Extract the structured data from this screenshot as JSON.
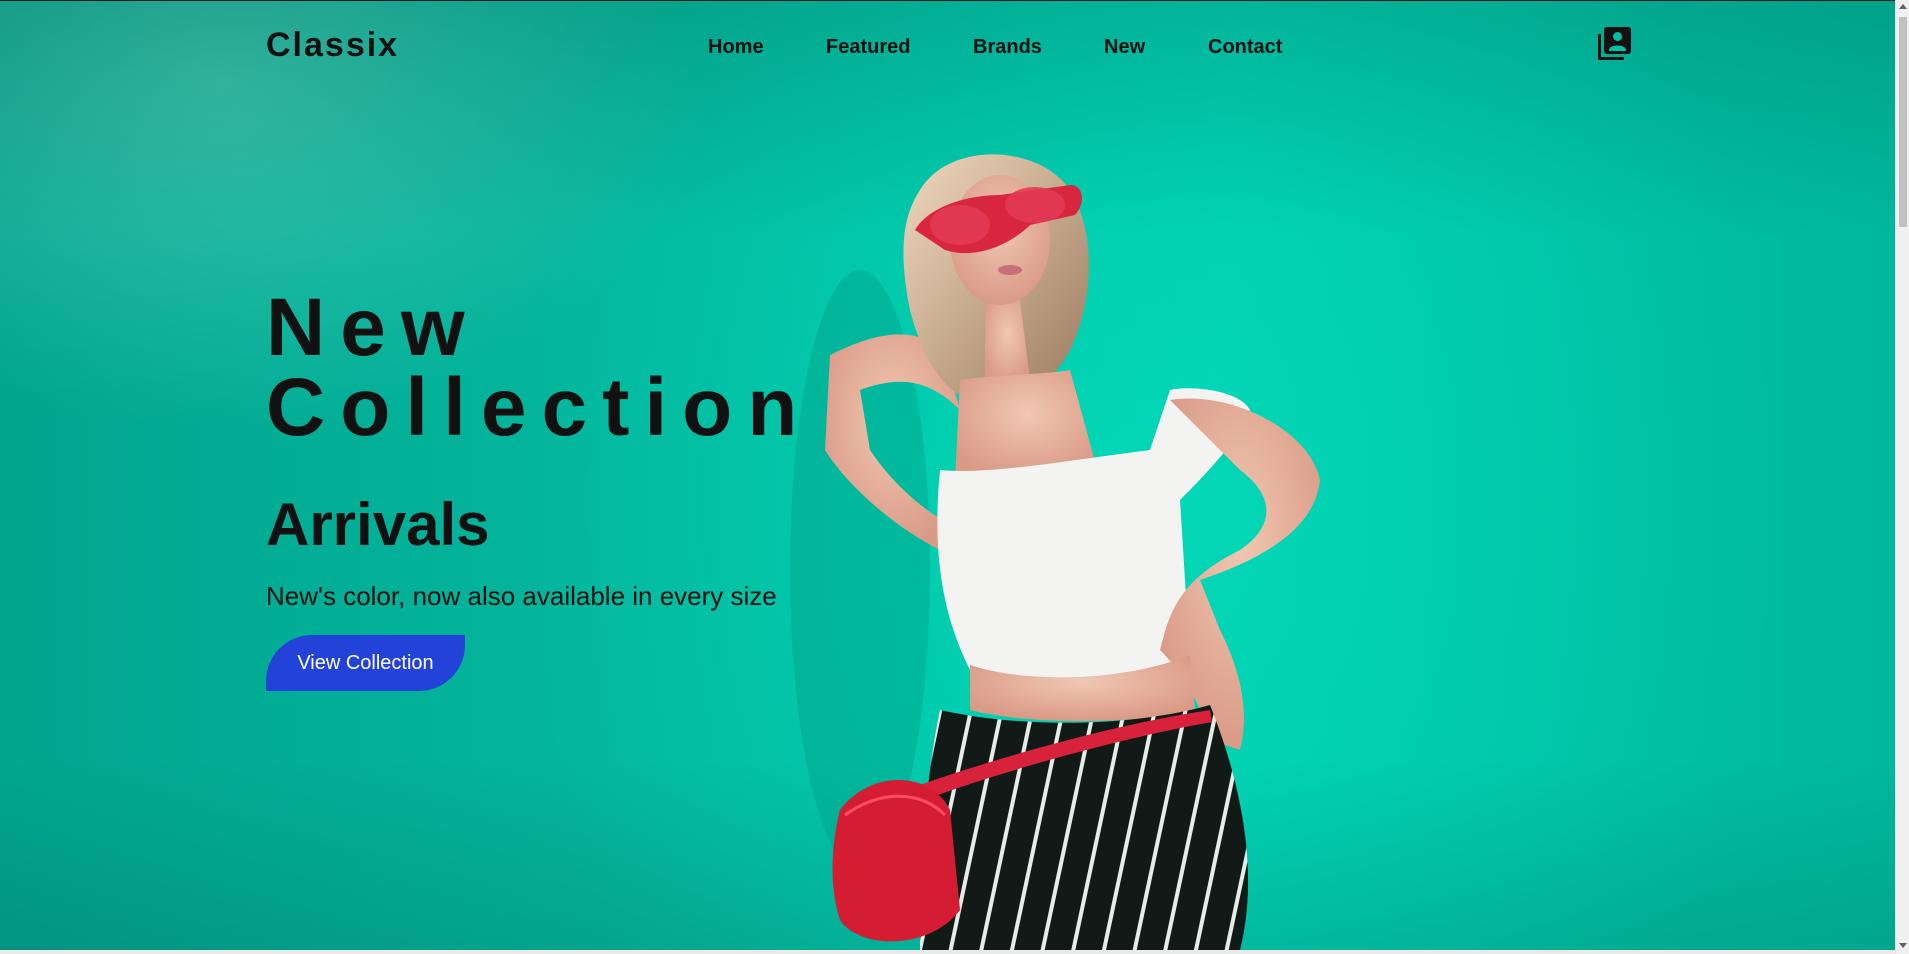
{
  "brand": {
    "logo": "Classix"
  },
  "nav": {
    "items": [
      {
        "label": "Home"
      },
      {
        "label": "Featured"
      },
      {
        "label": "Brands"
      },
      {
        "label": "New"
      },
      {
        "label": "Contact"
      }
    ],
    "account_icon": "account-box-icon"
  },
  "hero": {
    "title_line1": "New",
    "title_line2": "Collection",
    "subtitle": "Arrivals",
    "description": "New's color, now also available in every size",
    "cta_label": "View Collection",
    "image": "fashion-model-photo"
  },
  "colors": {
    "background": "#03bfa4",
    "text": "#111111",
    "button": "#2343d8",
    "button_text": "#ffffff"
  }
}
